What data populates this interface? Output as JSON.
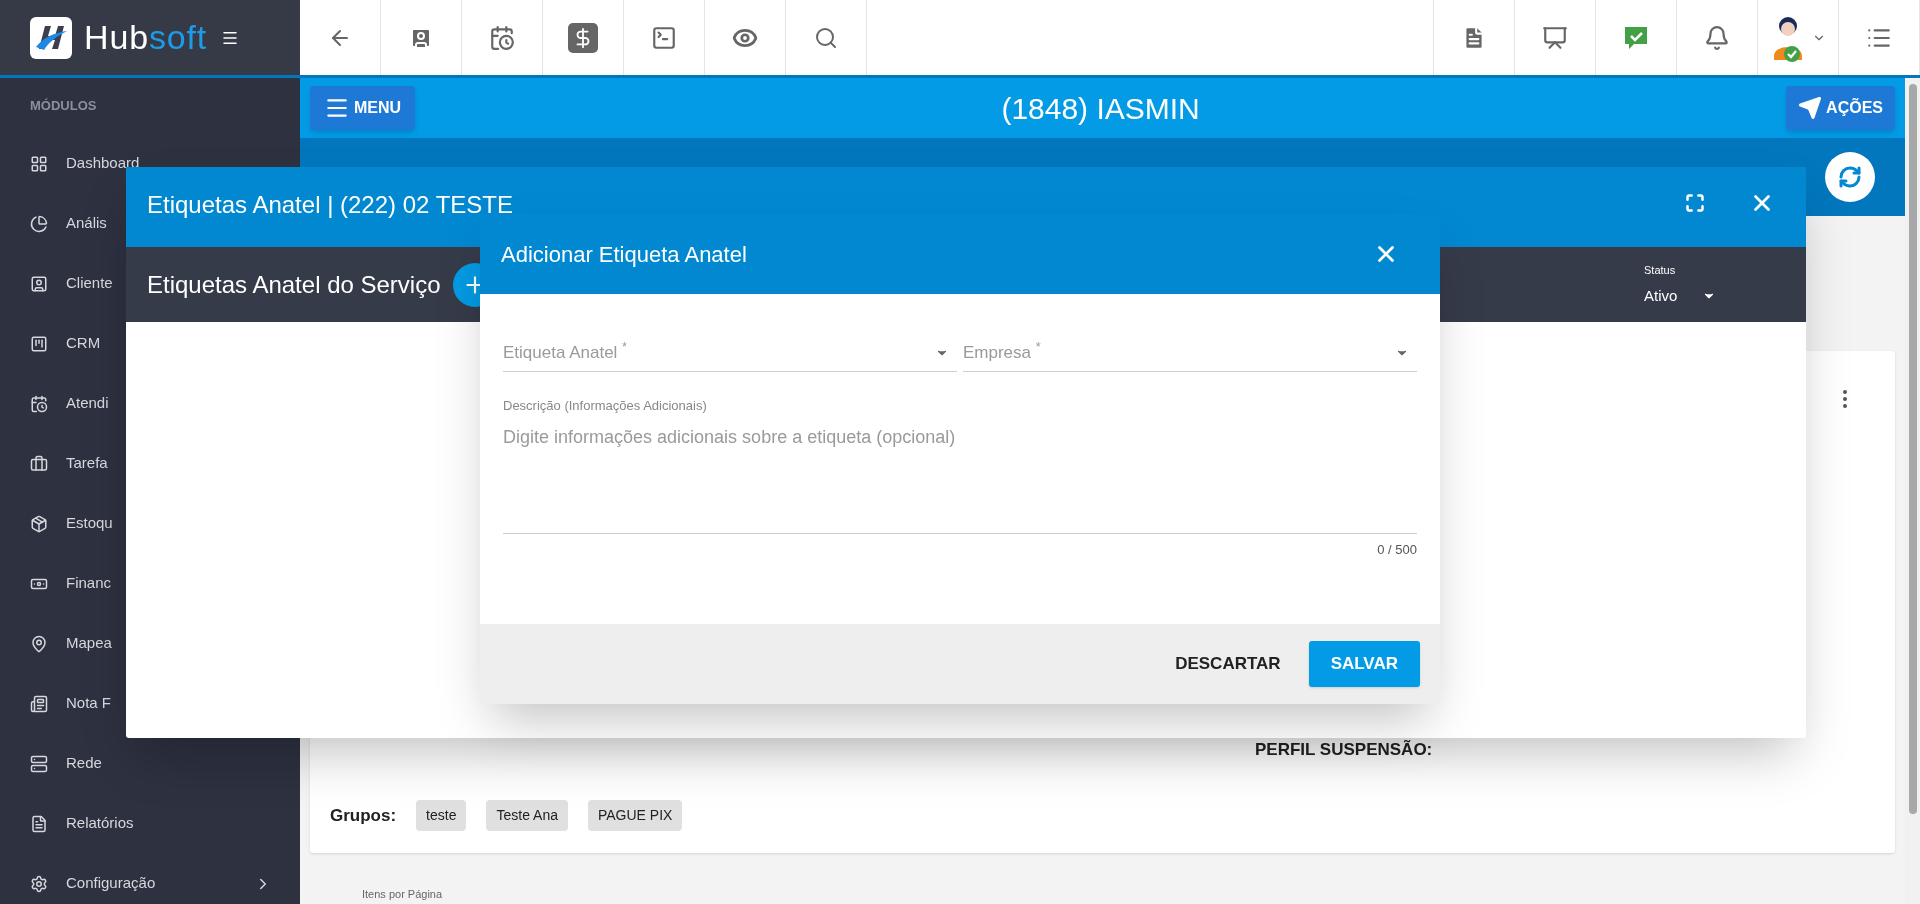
{
  "top_bar": {
    "logo": {
      "main": "Hub",
      "accent": "soft"
    }
  },
  "sidebar": {
    "heading": "MÓDULOS",
    "items": [
      {
        "label": "Dashboard",
        "expandable": false
      },
      {
        "label": "Anális"
      },
      {
        "label": "Cliente"
      },
      {
        "label": "CRM"
      },
      {
        "label": "Atendi"
      },
      {
        "label": "Tarefa"
      },
      {
        "label": "Estoqu"
      },
      {
        "label": "Financ"
      },
      {
        "label": "Mapea"
      },
      {
        "label": "Nota F"
      },
      {
        "label": "Rede",
        "expandable": false
      },
      {
        "label": "Relatórios",
        "expandable": false
      },
      {
        "label": "Configuração",
        "expandable": true
      }
    ]
  },
  "page": {
    "menu_button": "MENU",
    "title": "(1848) IASMIN",
    "actions_button": "AÇÕES",
    "card": {
      "suspension_label": "PERFIL SUSPENSÃO:",
      "groups_label": "Grupos:",
      "groups": [
        "teste",
        "Teste Ana",
        "PAGUE PIX"
      ]
    },
    "pagination_label": "Itens por Página"
  },
  "tags_dialog": {
    "title": "Etiquetas Anatel | (222) 02 TESTE",
    "section_title": "Etiquetas Anatel do Serviço",
    "status": {
      "label": "Status",
      "value": "Ativo"
    }
  },
  "add_dialog": {
    "title": "Adicionar Etiqueta Anatel",
    "fields": [
      {
        "label": "Etiqueta Anatel",
        "mark": "*"
      },
      {
        "label": "Empresa",
        "mark": "*"
      }
    ],
    "description": {
      "label": "Descrição (Informações Adicionais)",
      "placeholder": "Digite informações adicionais sobre a etiqueta (opcional)",
      "counter": "0 / 500"
    },
    "buttons": [
      {
        "label": "DESCARTAR",
        "kind": "text"
      },
      {
        "label": "SALVAR",
        "kind": "primary"
      }
    ]
  }
}
